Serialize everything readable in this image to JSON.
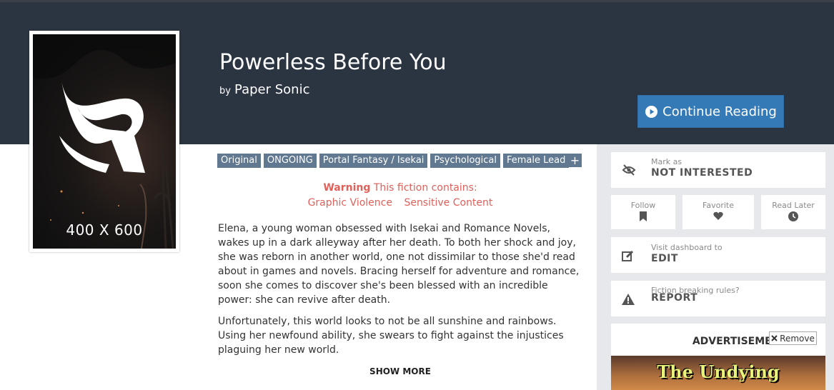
{
  "cover": {
    "size_label": "400 X 600"
  },
  "fiction": {
    "title": "Powerless Before You",
    "by": "by",
    "author": "Paper Sonic"
  },
  "buttons": {
    "continue_reading": "Continue Reading"
  },
  "tags": [
    "Original",
    "ONGOING",
    "Portal Fantasy / Isekai",
    "Psychological",
    "Female Lead"
  ],
  "tag_more": "+",
  "warning": {
    "label": "Warning",
    "text": "This fiction contains:",
    "items": [
      "Graphic Violence",
      "Sensitive Content"
    ]
  },
  "synopsis": [
    "Elena, a young woman obsessed with Isekai and Romance Novels, wakes up in a dark alleyway after her death. To both her shock and joy, she was reborn in another world, one not dissimilar to those she'd read about in games and novels. Bracing herself for adventure and romance, soon she comes to discover she's been blessed with an incredible power: she can revive after death.",
    "Unfortunately, this world looks to not be all sunshine and rainbows. Using her newfound ability, she swears to fight against the injustices plaguing her new world."
  ],
  "show_more": "SHOW MORE",
  "sidebar": {
    "not_interested": {
      "small": "Mark as",
      "big": "NOT INTERESTED"
    },
    "follow": "Follow",
    "favorite": "Favorite",
    "read_later": "Read Later",
    "edit": {
      "small": "Visit dashboard to",
      "big": "EDIT"
    },
    "report": {
      "small": "Fiction breaking rules?",
      "big": "REPORT"
    },
    "ad_title": "ADVERTISEMENT",
    "ad_remove": "Remove",
    "ad_image_text": "The Undying"
  },
  "colors": {
    "header_bg": "#2b3441",
    "accent": "#337ab7",
    "tag": "#607890",
    "warning": "#e0605a"
  },
  "icons": [
    "eye-slash-icon",
    "bookmark-icon",
    "heart-icon",
    "clock-icon",
    "edit-icon",
    "warning-icon",
    "play-circle-icon",
    "close-icon"
  ]
}
